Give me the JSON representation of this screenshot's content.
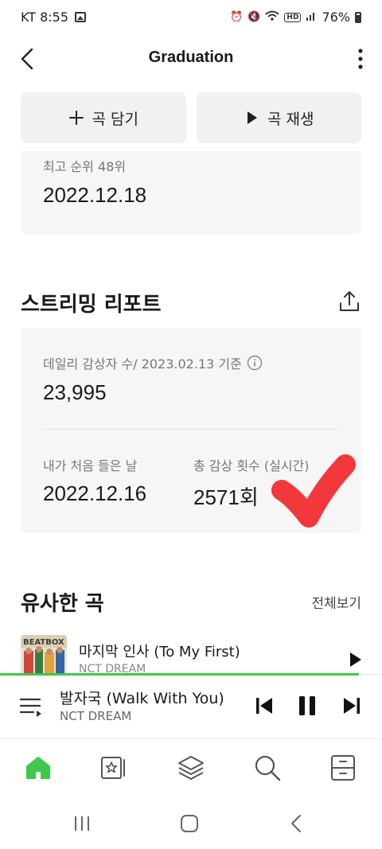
{
  "status_bar": {
    "carrier_time": "KT 8:55",
    "battery": "76%",
    "icons": [
      "alarm-icon",
      "mute-icon",
      "wifi-icon",
      "hd-icon",
      "signal-icon",
      "battery-icon"
    ]
  },
  "header": {
    "title": "Graduation"
  },
  "actions": {
    "add_label": "곡 담기",
    "play_label": "곡 재생"
  },
  "peak": {
    "label": "최고 순위 48위",
    "date": "2022.12.18"
  },
  "report": {
    "title": "스트리밍 리포트",
    "daily_label": "데일리 감상자 수/ 2023.02.13 기준",
    "daily_value": "23,995",
    "first_listen_label": "내가 처음 들은 날",
    "first_listen_value": "2022.12.16",
    "total_label": "총 감상 횟수 (실시간)",
    "total_value": "2571회"
  },
  "similar": {
    "title": "유사한 곡",
    "view_all": "전체보기",
    "songs": [
      {
        "title": "마지막 인사 (To My First)",
        "artist": "NCT DREAM"
      }
    ]
  },
  "now_playing": {
    "title": "발자국 (Walk With You)",
    "artist": "NCT DREAM",
    "progress": 0.94
  },
  "bottom_nav": [
    "home-icon",
    "library-icon",
    "layers-icon",
    "search-icon",
    "storage-icon"
  ],
  "colors": {
    "accent": "#3ec94a",
    "card_bg": "#f6f6f6",
    "button_bg": "#f1f1f1",
    "checkmark": "#f2383a"
  }
}
